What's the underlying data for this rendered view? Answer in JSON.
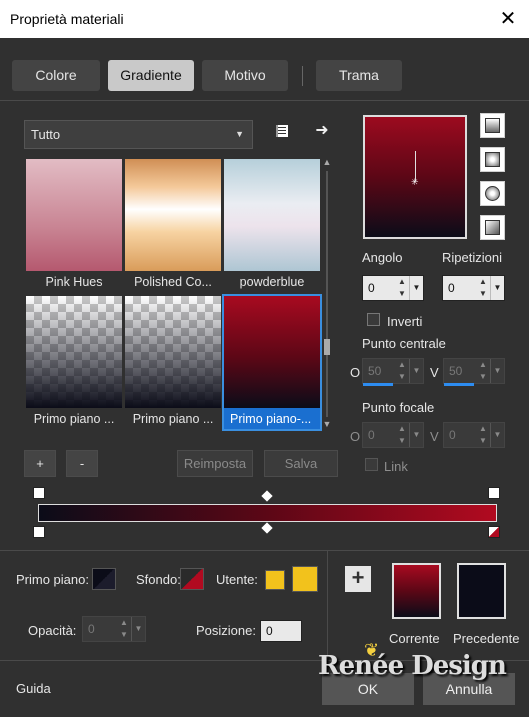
{
  "window": {
    "title": "Proprietà materiali",
    "close_icon": "✕"
  },
  "tabs": [
    {
      "label": "Colore"
    },
    {
      "label": "Gradiente"
    },
    {
      "label": "Motivo"
    },
    {
      "label": "Trama"
    }
  ],
  "library": {
    "category": "Tutto",
    "tiles": [
      {
        "label": "Pink Hues"
      },
      {
        "label": "Polished Co..."
      },
      {
        "label": "powderblue"
      },
      {
        "label": "Primo piano ..."
      },
      {
        "label": "Primo piano ..."
      },
      {
        "label": "Primo piano-..."
      }
    ],
    "add_label": "+",
    "remove_label": "-",
    "reset_label": "Reimposta",
    "save_label": "Salva"
  },
  "settings": {
    "angle_label": "Angolo",
    "angle_value": "0",
    "repeat_label": "Ripetizioni",
    "repeat_value": "0",
    "invert_label": "Inverti",
    "center_label": "Punto centrale",
    "center_h_label": "O",
    "center_h_value": "50",
    "center_v_label": "V",
    "center_v_value": "50",
    "focal_label": "Punto focale",
    "focal_h_label": "O",
    "focal_h_value": "0",
    "focal_v_label": "V",
    "focal_v_value": "0",
    "link_label": "Link"
  },
  "gradient_colors": {
    "start": "#0b0c18",
    "mid": "#5c0716",
    "end": "#b10a20"
  },
  "lower": {
    "foreground_label": "Primo piano:",
    "background_label": "Sfondo:",
    "user_label": "Utente:",
    "user_color": "#f2c21c",
    "opacity_label": "Opacità:",
    "opacity_value": "0",
    "position_label": "Posizione:",
    "position_value": "0",
    "current_label": "Corrente",
    "previous_label": "Precedente"
  },
  "footer": {
    "help_label": "Guida",
    "ok_label": "OK",
    "cancel_label": "Annulla",
    "watermark": "Renée Design"
  }
}
